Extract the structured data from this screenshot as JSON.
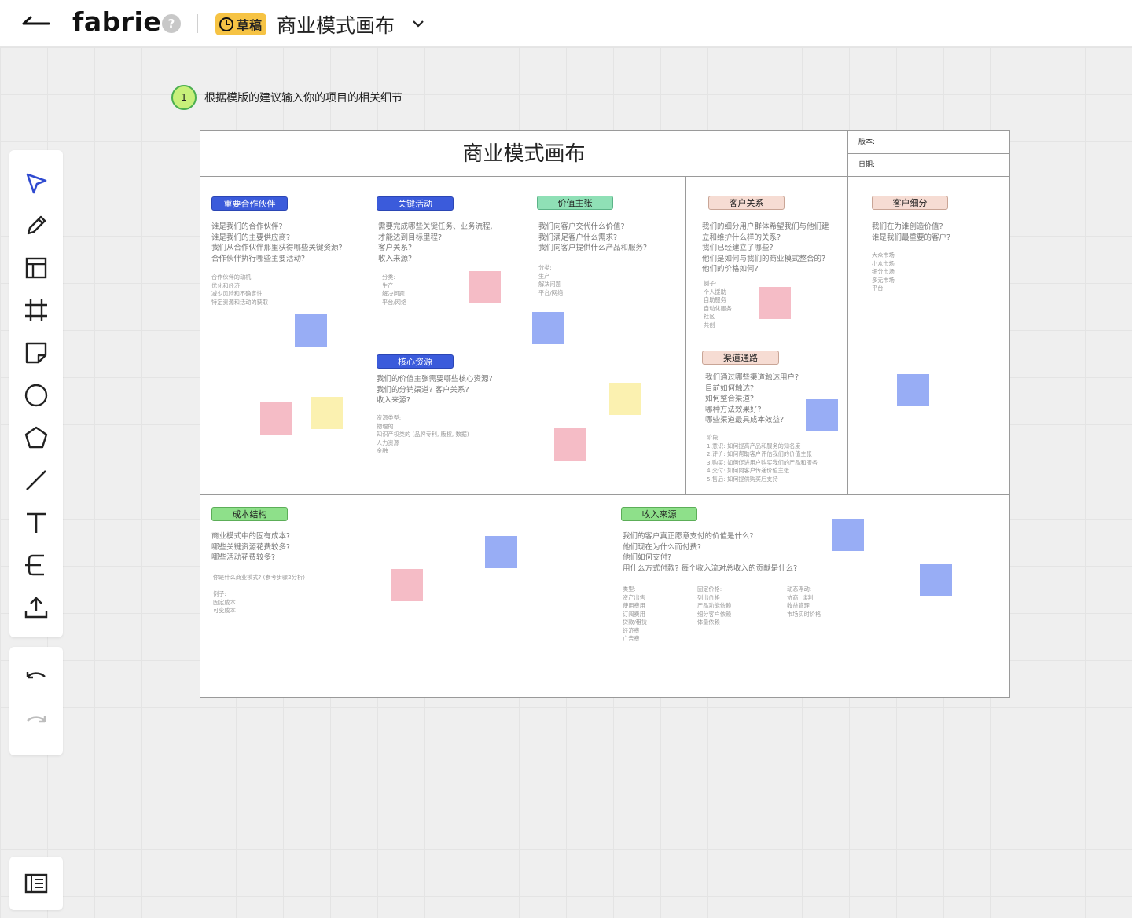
{
  "header": {
    "logo": "fabrie",
    "help": "?",
    "draft_label": "草稿",
    "doc_title": "商业模式画布"
  },
  "hint": {
    "step": "1",
    "text": "根据模版的建议输入你的项目的相关细节"
  },
  "toolbar": {
    "tools": [
      "select-icon",
      "pen-icon",
      "template-icon",
      "frame-icon",
      "sticky-note-icon",
      "circle-icon",
      "pentagon-icon",
      "line-icon",
      "text-icon",
      "connector-icon",
      "upload-icon"
    ],
    "history": [
      "undo-icon",
      "redo-icon"
    ]
  },
  "board": {
    "title": "商业模式画布",
    "version_label": "版本:",
    "date_label": "日期:",
    "partners": {
      "tag": "重要合作伙伴",
      "questions": "谁是我们的合作伙伴?\n谁是我们的主要供应商?\n我们从合作伙伴那里获得哪些关键资源?\n合作伙伴执行哪些主要活动?",
      "notes": "合作伙伴的动机:\n优化和经济\n减少风险和不确定性\n特定资源和活动的获取"
    },
    "activities": {
      "tag": "关键活动",
      "questions": "需要完成哪些关键任务、业务流程,\n才能达到目标里程?\n客户关系?\n收入来源?",
      "notes": "分类:\n生产\n解决问题\n平台/网络"
    },
    "resources": {
      "tag": "核心资源",
      "questions": "我们的价值主张需要哪些核心资源?\n我们的分销渠道? 客户关系?\n收入来源?",
      "notes": "资源类型:\n物理的\n知识产权类的 (品牌专利, 版权, 数据)\n人力资源\n金融"
    },
    "value": {
      "tag": "价值主张",
      "questions": "我们向客户交代什么价值?\n我们满足客户什么需求?\n我们向客户提供什么产品和服务?",
      "notes": "分类:\n生产\n解决问题\n平台/网络"
    },
    "relationships": {
      "tag": "客户关系",
      "questions": "我们的细分用户群体希望我们与他们建\n立和维护什么样的关系?\n我们已经建立了哪些?\n他们是如何与我们的商业模式整合的?\n他们的价格如何?",
      "notes": "例子:\n个人援助\n自助服务\n自动化服务\n社区\n共创"
    },
    "channels": {
      "tag": "渠道通路",
      "questions": "我们通过哪些渠道触达用户?\n目前如何触达?\n如何整合渠道?\n哪种方法效果好?\n哪些渠道最具成本效益?",
      "notes": "阶段:\n1.意识: 如何提高产品和服务的知名度\n2.评价: 如何帮助客户评估我们的价值主张\n3.购买: 如何促进用户购买我们的产品和服务\n4.交付: 如何向客户传递价值主张\n5.售后: 如何提供购买后支持"
    },
    "segments": {
      "tag": "客户细分",
      "questions": "我们在为谁创造价值?\n谁是我们最重要的客户?",
      "notes": "大众市场\n小众市场\n细分市场\n多元市场\n平台"
    },
    "cost": {
      "tag": "成本结构",
      "questions": "商业模式中的固有成本?\n哪些关键资源花费较多?\n哪些活动花费较多?",
      "hint": "你是什么商业模式? (参考步骤2分析)",
      "notes": "例子:\n固定成本\n可变成本"
    },
    "revenue": {
      "tag": "收入来源",
      "questions": "我们的客户真正愿意支付的价值是什么?\n他们现在为什么而付费?\n他们如何支付?\n用什么方式付款? 每个收入流对总收入的贡献是什么?",
      "notes_types": "类型:\n资产出售\n使用费用\n订阅费用\n贷款/租赁\n经济费\n广告费",
      "notes_fixed": "固定价格:\n列出价格\n产品功能依赖\n细分客户依赖\n体量依赖",
      "notes_dynamic": "动态浮动:\n协商, 谈判\n收益管理\n市场实时价格"
    }
  },
  "colors": {
    "sticky_blue": "#98adf5",
    "sticky_pink": "#f5bcc6",
    "sticky_yellow": "#fbf1b0",
    "draft": "#f6c344",
    "tag_blue": "#3b5bdb",
    "tag_green": "#8ee08a"
  }
}
